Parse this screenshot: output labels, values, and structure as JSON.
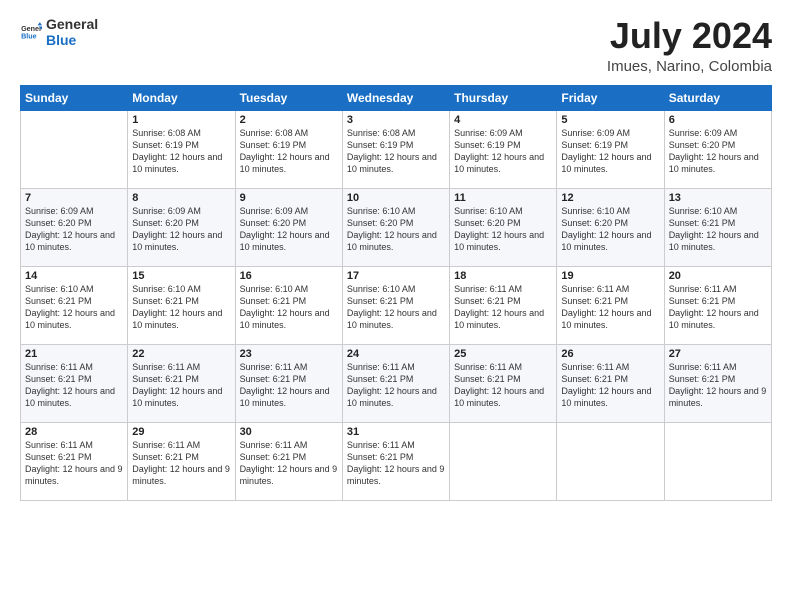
{
  "logo": {
    "general": "General",
    "blue": "Blue"
  },
  "title": "July 2024",
  "subtitle": "Imues, Narino, Colombia",
  "header": {
    "days": [
      "Sunday",
      "Monday",
      "Tuesday",
      "Wednesday",
      "Thursday",
      "Friday",
      "Saturday"
    ]
  },
  "weeks": [
    [
      {
        "day": "",
        "sunrise": "",
        "sunset": "",
        "daylight": ""
      },
      {
        "day": "1",
        "sunrise": "6:08 AM",
        "sunset": "6:19 PM",
        "daylight": "12 hours and 10 minutes."
      },
      {
        "day": "2",
        "sunrise": "6:08 AM",
        "sunset": "6:19 PM",
        "daylight": "12 hours and 10 minutes."
      },
      {
        "day": "3",
        "sunrise": "6:08 AM",
        "sunset": "6:19 PM",
        "daylight": "12 hours and 10 minutes."
      },
      {
        "day": "4",
        "sunrise": "6:09 AM",
        "sunset": "6:19 PM",
        "daylight": "12 hours and 10 minutes."
      },
      {
        "day": "5",
        "sunrise": "6:09 AM",
        "sunset": "6:19 PM",
        "daylight": "12 hours and 10 minutes."
      },
      {
        "day": "6",
        "sunrise": "6:09 AM",
        "sunset": "6:20 PM",
        "daylight": "12 hours and 10 minutes."
      }
    ],
    [
      {
        "day": "7",
        "sunrise": "6:09 AM",
        "sunset": "6:20 PM",
        "daylight": "12 hours and 10 minutes."
      },
      {
        "day": "8",
        "sunrise": "6:09 AM",
        "sunset": "6:20 PM",
        "daylight": "12 hours and 10 minutes."
      },
      {
        "day": "9",
        "sunrise": "6:09 AM",
        "sunset": "6:20 PM",
        "daylight": "12 hours and 10 minutes."
      },
      {
        "day": "10",
        "sunrise": "6:10 AM",
        "sunset": "6:20 PM",
        "daylight": "12 hours and 10 minutes."
      },
      {
        "day": "11",
        "sunrise": "6:10 AM",
        "sunset": "6:20 PM",
        "daylight": "12 hours and 10 minutes."
      },
      {
        "day": "12",
        "sunrise": "6:10 AM",
        "sunset": "6:20 PM",
        "daylight": "12 hours and 10 minutes."
      },
      {
        "day": "13",
        "sunrise": "6:10 AM",
        "sunset": "6:21 PM",
        "daylight": "12 hours and 10 minutes."
      }
    ],
    [
      {
        "day": "14",
        "sunrise": "6:10 AM",
        "sunset": "6:21 PM",
        "daylight": "12 hours and 10 minutes."
      },
      {
        "day": "15",
        "sunrise": "6:10 AM",
        "sunset": "6:21 PM",
        "daylight": "12 hours and 10 minutes."
      },
      {
        "day": "16",
        "sunrise": "6:10 AM",
        "sunset": "6:21 PM",
        "daylight": "12 hours and 10 minutes."
      },
      {
        "day": "17",
        "sunrise": "6:10 AM",
        "sunset": "6:21 PM",
        "daylight": "12 hours and 10 minutes."
      },
      {
        "day": "18",
        "sunrise": "6:11 AM",
        "sunset": "6:21 PM",
        "daylight": "12 hours and 10 minutes."
      },
      {
        "day": "19",
        "sunrise": "6:11 AM",
        "sunset": "6:21 PM",
        "daylight": "12 hours and 10 minutes."
      },
      {
        "day": "20",
        "sunrise": "6:11 AM",
        "sunset": "6:21 PM",
        "daylight": "12 hours and 10 minutes."
      }
    ],
    [
      {
        "day": "21",
        "sunrise": "6:11 AM",
        "sunset": "6:21 PM",
        "daylight": "12 hours and 10 minutes."
      },
      {
        "day": "22",
        "sunrise": "6:11 AM",
        "sunset": "6:21 PM",
        "daylight": "12 hours and 10 minutes."
      },
      {
        "day": "23",
        "sunrise": "6:11 AM",
        "sunset": "6:21 PM",
        "daylight": "12 hours and 10 minutes."
      },
      {
        "day": "24",
        "sunrise": "6:11 AM",
        "sunset": "6:21 PM",
        "daylight": "12 hours and 10 minutes."
      },
      {
        "day": "25",
        "sunrise": "6:11 AM",
        "sunset": "6:21 PM",
        "daylight": "12 hours and 10 minutes."
      },
      {
        "day": "26",
        "sunrise": "6:11 AM",
        "sunset": "6:21 PM",
        "daylight": "12 hours and 10 minutes."
      },
      {
        "day": "27",
        "sunrise": "6:11 AM",
        "sunset": "6:21 PM",
        "daylight": "12 hours and 9 minutes."
      }
    ],
    [
      {
        "day": "28",
        "sunrise": "6:11 AM",
        "sunset": "6:21 PM",
        "daylight": "12 hours and 9 minutes."
      },
      {
        "day": "29",
        "sunrise": "6:11 AM",
        "sunset": "6:21 PM",
        "daylight": "12 hours and 9 minutes."
      },
      {
        "day": "30",
        "sunrise": "6:11 AM",
        "sunset": "6:21 PM",
        "daylight": "12 hours and 9 minutes."
      },
      {
        "day": "31",
        "sunrise": "6:11 AM",
        "sunset": "6:21 PM",
        "daylight": "12 hours and 9 minutes."
      },
      {
        "day": "",
        "sunrise": "",
        "sunset": "",
        "daylight": ""
      },
      {
        "day": "",
        "sunrise": "",
        "sunset": "",
        "daylight": ""
      },
      {
        "day": "",
        "sunrise": "",
        "sunset": "",
        "daylight": ""
      }
    ]
  ]
}
